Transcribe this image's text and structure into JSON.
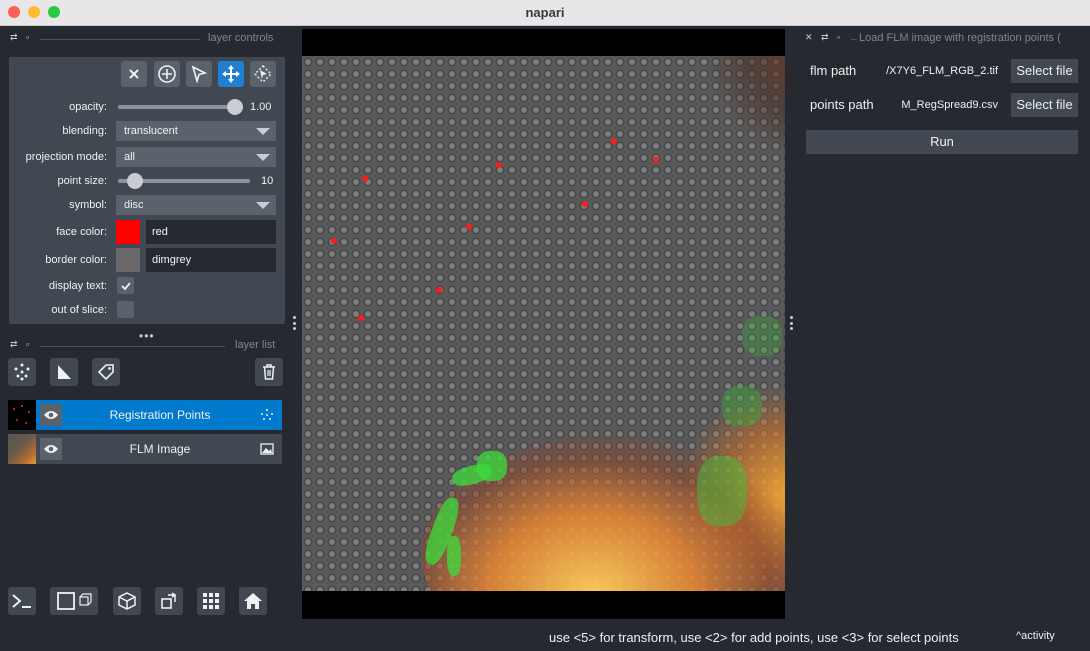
{
  "window": {
    "title": "napari"
  },
  "layer_controls": {
    "header": "layer controls",
    "opacity": {
      "label": "opacity:",
      "value": "1.00",
      "level": 1.0
    },
    "blending": {
      "label": "blending:",
      "value": "translucent"
    },
    "projection_mode": {
      "label": "projection mode:",
      "value": "all"
    },
    "point_size": {
      "label": "point size:",
      "value": "10",
      "level": 0.08
    },
    "symbol": {
      "label": "symbol:",
      "value": "disc"
    },
    "face_color": {
      "label": "face color:",
      "value": "red",
      "swatch": "#ff0000"
    },
    "border_color": {
      "label": "border color:",
      "value": "dimgrey",
      "swatch": "#696969"
    },
    "display_text": {
      "label": "display text:",
      "checked": true
    },
    "out_of_slice": {
      "label": "out of slice:",
      "checked": false
    },
    "tools": [
      "delete-selected",
      "add-points",
      "select-points",
      "transform",
      "select-rotate"
    ],
    "active_tool": "transform"
  },
  "layer_list": {
    "header": "layer list",
    "layers": [
      {
        "name": "Registration Points",
        "selected": true,
        "icon": "points-icon"
      },
      {
        "name": "FLM Image",
        "selected": false,
        "icon": "image-icon"
      }
    ]
  },
  "plugin": {
    "header": "Load FLM image with registration points (",
    "flm_label": "flm path",
    "flm_value": "/X7Y6_FLM_RGB_2.tif",
    "points_label": "points path",
    "points_value": "M_RegSpread9.csv",
    "select_file": "Select file",
    "run": "Run"
  },
  "status": {
    "message": "use <5> for transform, use <2> for add points, use <3> for select points",
    "activity": "activity"
  },
  "colors": {
    "accent": "#007acc",
    "background": "#262930",
    "panel": "#414851",
    "point": "#ff1b1b"
  }
}
